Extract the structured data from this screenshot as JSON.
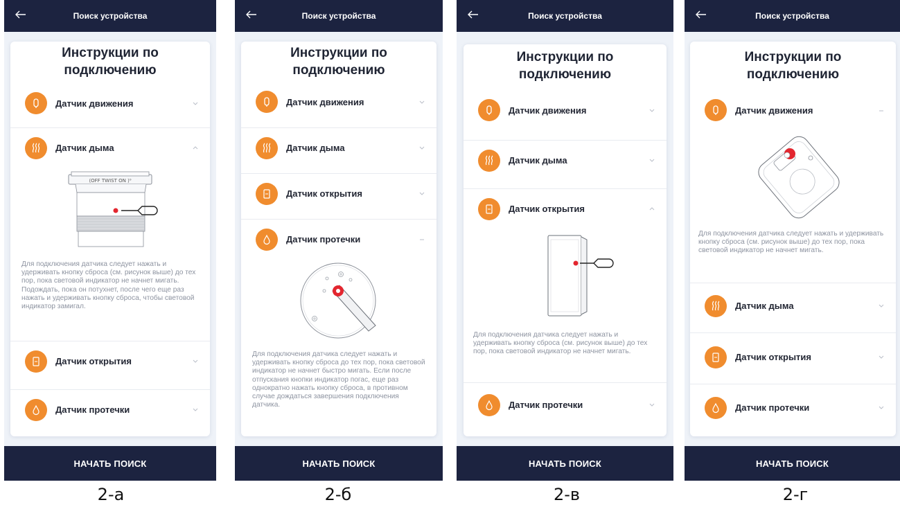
{
  "common": {
    "header_title": "Поиск устройства",
    "heading_line1": "Инструкции по",
    "heading_line2": "подключению",
    "start_button": "НАЧАТЬ ПОИСК"
  },
  "colors": {
    "nav": "#1c2340",
    "accent": "#f08c2e",
    "reset_dot": "#e3262f"
  },
  "screens": [
    {
      "caption": "2-а",
      "expanded": "smoke",
      "rows": [
        {
          "label": "Датчик движения",
          "icon": "motion-sensor-icon"
        },
        {
          "label": "Датчик дыма",
          "icon": "smoke-sensor-icon"
        },
        {
          "label": "Датчик открытия",
          "icon": "door-sensor-icon"
        },
        {
          "label": "Датчик протечки",
          "icon": "leak-sensor-icon"
        }
      ],
      "device_text": "⟨OFF TWIST ON ⟩⁰",
      "instruction": "Для подключения датчика следует нажать и удерживать кнопку сброса (см. рисунок выше) до тех пор, пока световой индикатор не начнет мигать. Подождать, пока он потухнет, после чего еще раз нажать и удерживать кнопку сброса, чтобы световой индикатор замигал."
    },
    {
      "caption": "2-б",
      "expanded": "leak",
      "rows": [
        {
          "label": "Датчик движения",
          "icon": "motion-sensor-icon"
        },
        {
          "label": "Датчик дыма",
          "icon": "smoke-sensor-icon"
        },
        {
          "label": "Датчик открытия",
          "icon": "door-sensor-icon"
        },
        {
          "label": "Датчик протечки",
          "icon": "leak-sensor-icon"
        }
      ],
      "instruction": "Для подключения датчика следует нажать и удерживать кнопку сброса до тех пор, пока световой индикатор не начнет быстро мигать. Если после отпускания кнопки индикатор погас, еще раз однократно нажать кнопку сброса, в противном случае дождаться завершения подключения датчика."
    },
    {
      "caption": "2-в",
      "expanded": "door",
      "rows": [
        {
          "label": "Датчик движения",
          "icon": "motion-sensor-icon"
        },
        {
          "label": "Датчик дыма",
          "icon": "smoke-sensor-icon"
        },
        {
          "label": "Датчик открытия",
          "icon": "door-sensor-icon"
        },
        {
          "label": "Датчик протечки",
          "icon": "leak-sensor-icon"
        }
      ],
      "instruction": "Для подключения датчика следует нажать и удерживать кнопку сброса (см. рисунок выше) до тех пор, пока световой индикатор не начнет мигать."
    },
    {
      "caption": "2-г",
      "expanded": "motion",
      "rows": [
        {
          "label": "Датчик движения",
          "icon": "motion-sensor-icon"
        },
        {
          "label": "Датчик дыма",
          "icon": "smoke-sensor-icon"
        },
        {
          "label": "Датчик открытия",
          "icon": "door-sensor-icon"
        },
        {
          "label": "Датчик протечки",
          "icon": "leak-sensor-icon"
        }
      ],
      "instruction": "Для подключения датчика следует нажать и удерживать кнопку сброса (см. рисунок выше) до тех пор, пока световой индикатор не начнет мигать."
    }
  ]
}
